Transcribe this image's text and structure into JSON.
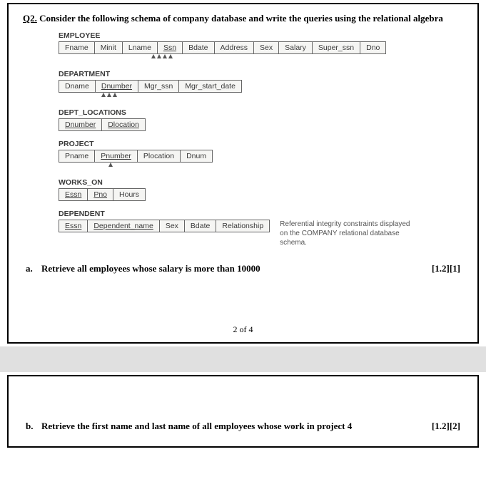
{
  "question": {
    "number": "Q2.",
    "text": "Consider the following schema of company database and write the queries using the relational algebra"
  },
  "schema": {
    "relations": [
      {
        "name": "EMPLOYEE",
        "attrs": [
          {
            "n": "Fname",
            "k": false
          },
          {
            "n": "Minit",
            "k": false
          },
          {
            "n": "Lname",
            "k": false
          },
          {
            "n": "Ssn",
            "k": true
          },
          {
            "n": "Bdate",
            "k": false
          },
          {
            "n": "Address",
            "k": false
          },
          {
            "n": "Sex",
            "k": false
          },
          {
            "n": "Salary",
            "k": false
          },
          {
            "n": "Super_ssn",
            "k": false
          },
          {
            "n": "Dno",
            "k": false
          }
        ],
        "arrows_after": 4
      },
      {
        "name": "DEPARTMENT",
        "attrs": [
          {
            "n": "Dname",
            "k": false
          },
          {
            "n": "Dnumber",
            "k": true
          },
          {
            "n": "Mgr_ssn",
            "k": false
          },
          {
            "n": "Mgr_start_date",
            "k": false
          }
        ],
        "arrows_after": 3
      },
      {
        "name": "DEPT_LOCATIONS",
        "attrs": [
          {
            "n": "Dnumber",
            "k": true
          },
          {
            "n": "Dlocation",
            "k": true
          }
        ],
        "arrows_after": 0
      },
      {
        "name": "PROJECT",
        "attrs": [
          {
            "n": "Pname",
            "k": false
          },
          {
            "n": "Pnumber",
            "k": true
          },
          {
            "n": "Plocation",
            "k": false
          },
          {
            "n": "Dnum",
            "k": false
          }
        ],
        "arrows_after": 1
      },
      {
        "name": "WORKS_ON",
        "attrs": [
          {
            "n": "Essn",
            "k": true
          },
          {
            "n": "Pno",
            "k": true
          },
          {
            "n": "Hours",
            "k": false
          }
        ],
        "arrows_after": 0
      },
      {
        "name": "DEPENDENT",
        "attrs": [
          {
            "n": "Essn",
            "k": true
          },
          {
            "n": "Dependent_name",
            "k": true
          },
          {
            "n": "Sex",
            "k": false
          },
          {
            "n": "Bdate",
            "k": false
          },
          {
            "n": "Relationship",
            "k": false
          }
        ],
        "arrows_after": 0
      }
    ],
    "ref_note": "Referential integrity constraints displayed on the COMPANY relational database schema."
  },
  "subquestions": {
    "a": {
      "letter": "a.",
      "text": "Retrieve all employees whose salary is more than 10000",
      "marks": "[1.2][1]"
    },
    "b": {
      "letter": "b.",
      "text": "Retrieve the first name and last name of all employees whose work in project 4",
      "marks": "[1.2][2]"
    }
  },
  "page_label": "2 of 4"
}
